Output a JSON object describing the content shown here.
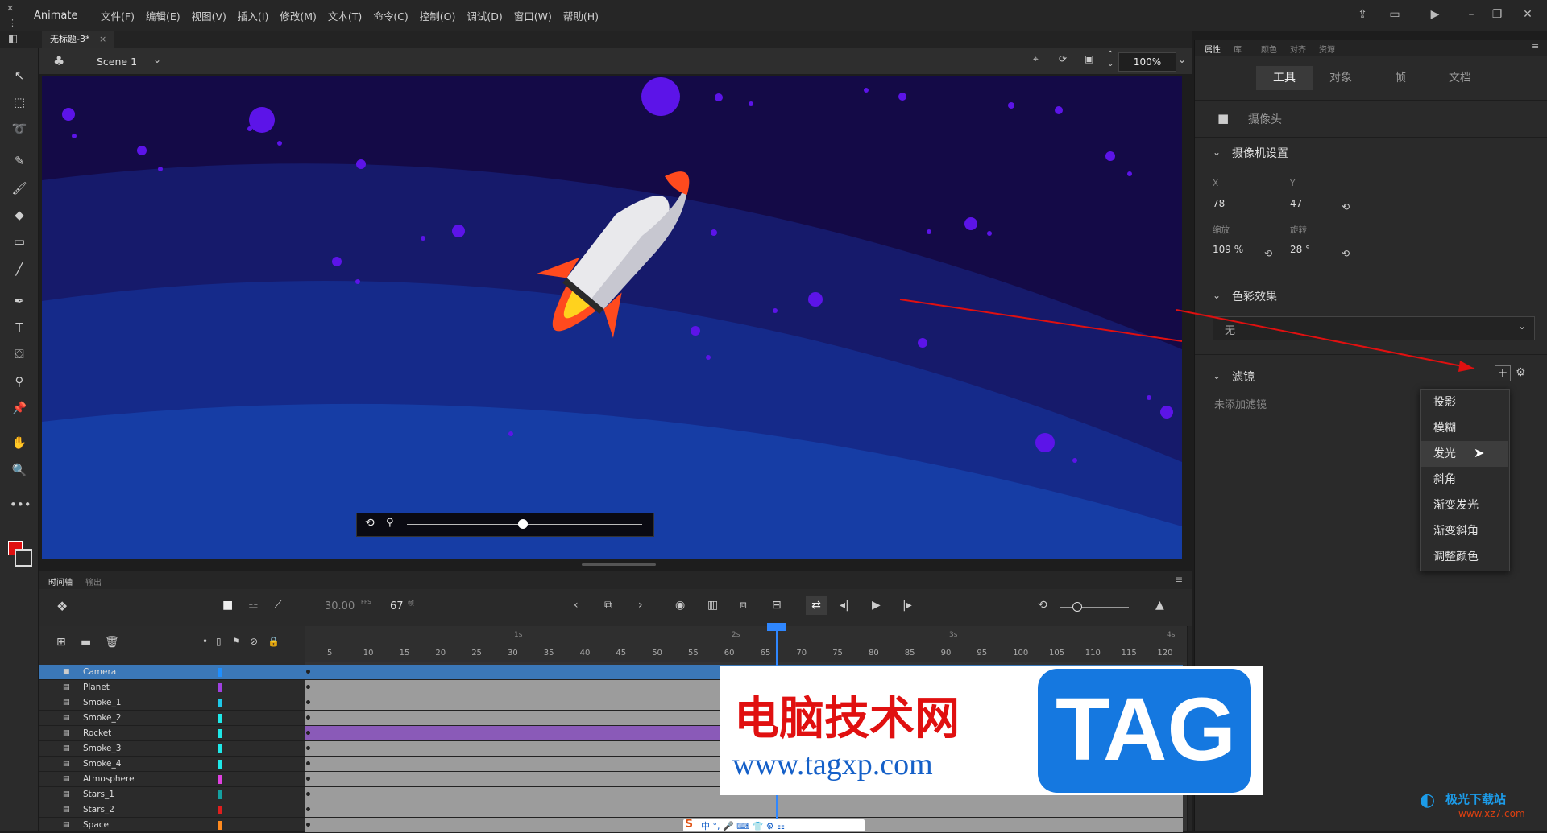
{
  "app_name": "Animate",
  "menus": [
    "文件(F)",
    "编辑(E)",
    "视图(V)",
    "插入(I)",
    "修改(M)",
    "文本(T)",
    "命令(C)",
    "控制(O)",
    "调试(D)",
    "窗口(W)",
    "帮助(H)"
  ],
  "document_tab": "无标题-3*",
  "scene": "Scene 1",
  "zoom": "100%",
  "timeline": {
    "tabs": [
      "时间轴",
      "输出"
    ],
    "fps": "30.00",
    "fps_unit": "FPS",
    "current_frame": "67",
    "frame_unit": "帧",
    "second_marks": [
      "1s",
      "2s",
      "3s",
      "4s"
    ],
    "frame_ticks": [
      "5",
      "10",
      "15",
      "20",
      "25",
      "30",
      "35",
      "40",
      "45",
      "50",
      "55",
      "60",
      "65",
      "70",
      "75",
      "80",
      "85",
      "90",
      "95",
      "100",
      "105",
      "110",
      "115",
      "120"
    ],
    "layers": [
      {
        "name": "Camera",
        "color": "#1e8fff"
      },
      {
        "name": "Planet",
        "color": "#a040e0"
      },
      {
        "name": "Smoke_1",
        "color": "#1ec8e8"
      },
      {
        "name": "Smoke_2",
        "color": "#1ee8e8"
      },
      {
        "name": "Rocket",
        "color": "#1ee8e8"
      },
      {
        "name": "Smoke_3",
        "color": "#1ee8e8"
      },
      {
        "name": "Smoke_4",
        "color": "#1ee8e8"
      },
      {
        "name": "Atmosphere",
        "color": "#e040e0"
      },
      {
        "name": "Stars_1",
        "color": "#14a0a0"
      },
      {
        "name": "Stars_2",
        "color": "#e01e1e"
      },
      {
        "name": "Space",
        "color": "#ff8a1e"
      }
    ]
  },
  "panel": {
    "top_tabs": [
      "属性",
      "库",
      "颜色",
      "对齐",
      "资源"
    ],
    "tabs": [
      "工具",
      "对象",
      "帧",
      "文档"
    ],
    "camera_label": "摄像头",
    "camera_settings_title": "摄像机设置",
    "x_label": "X",
    "x_value": "78",
    "y_label": "Y",
    "y_value": "47",
    "scale_label": "缩放",
    "scale_value": "109 %",
    "rotation_label": "旋转",
    "rotation_value": "28 °",
    "color_effect_title": "色彩效果",
    "color_effect_value": "无",
    "filter_title": "滤镜",
    "no_filter_text": "未添加滤镜",
    "filter_menu": [
      "投影",
      "模糊",
      "发光",
      "斜角",
      "渐变发光",
      "渐变斜角",
      "调整颜色"
    ]
  },
  "watermark": {
    "site_name": "电脑技术网",
    "url": "www.tagxp.com",
    "tag": "TAG",
    "corner_text": "极光下载站",
    "corner_url": "www.xz7.com"
  }
}
